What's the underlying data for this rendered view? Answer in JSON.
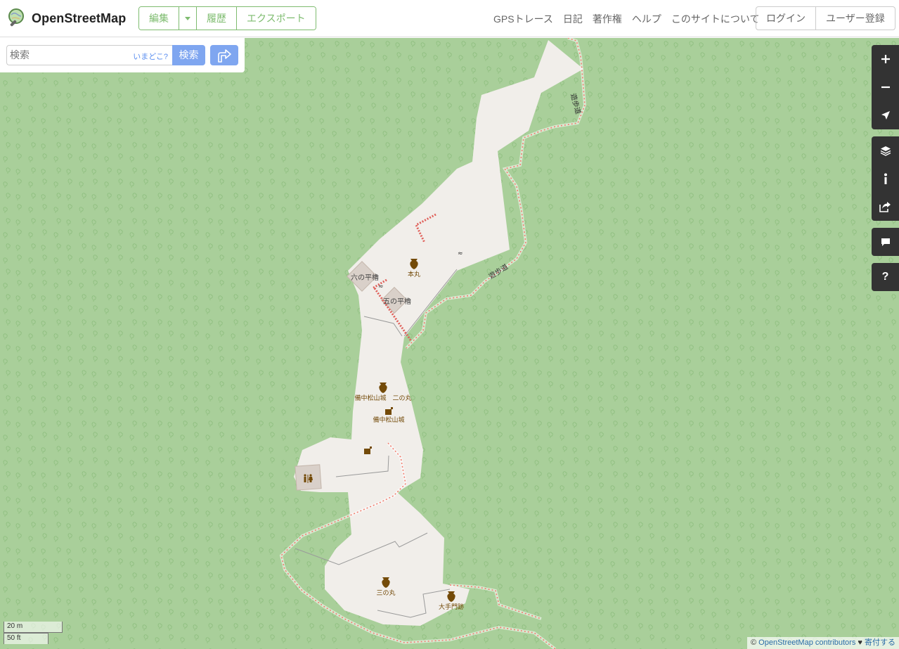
{
  "header": {
    "logo_text": "OpenStreetMap",
    "edit_label": "編集",
    "history_label": "履歴",
    "export_label": "エクスポート",
    "nav": [
      "GPSトレース",
      "日記",
      "著作権",
      "ヘルプ",
      "このサイトについて"
    ],
    "login_label": "ログイン",
    "signup_label": "ユーザー登録"
  },
  "search": {
    "placeholder": "検索",
    "where_link": "いまどこ?",
    "button_label": "検索"
  },
  "map": {
    "labels": {
      "path_north": "遊歩道",
      "path_mid": "遊歩道",
      "honmaru": "本丸",
      "rokunohira": "六の平櫓",
      "gonohira": "五の平櫓",
      "castle_ninomaru": "備中松山城　二の丸",
      "castle": "備中松山城",
      "sannomaru": "三の丸",
      "otemon": "大手門跡"
    },
    "colors": {
      "woodland": "#a9cf9a",
      "site": "#f1eeea",
      "building": "#d9d0c9",
      "path": "#fa8072",
      "historic": "#734a08"
    }
  },
  "controls": {
    "zoom_in": "zoom-in-icon",
    "zoom_out": "zoom-out-icon",
    "locate": "location-arrow-icon",
    "layers": "layers-icon",
    "info": "info-icon",
    "share": "share-icon",
    "note": "comment-icon",
    "help_label": "?"
  },
  "scale": {
    "metric": "20 m",
    "imperial": "50 ft"
  },
  "attribution": {
    "prefix": "© ",
    "link": "OpenStreetMap contributors",
    "heart": " ♥ ",
    "donate": "寄付する"
  }
}
